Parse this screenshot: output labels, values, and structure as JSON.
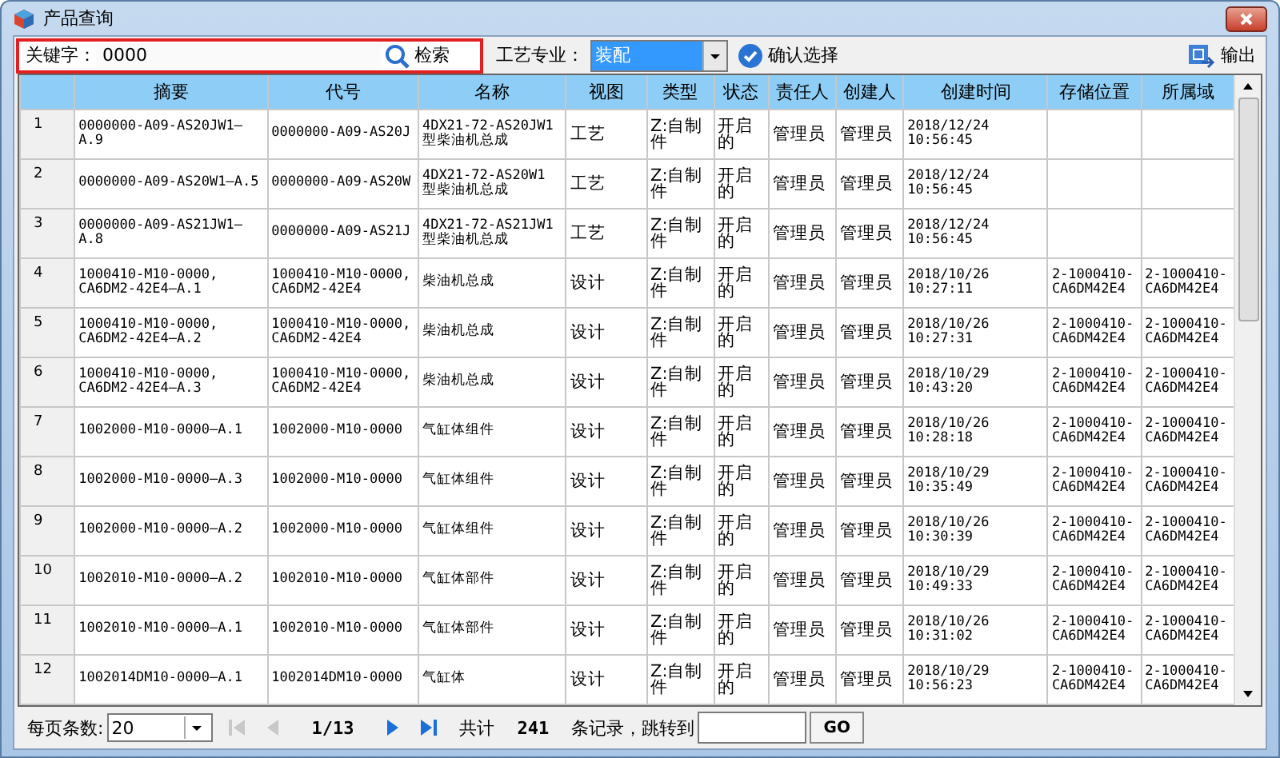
{
  "window": {
    "title": "产品查询"
  },
  "toolbar": {
    "keyword": {
      "label": "关键字：",
      "value": "0000",
      "highlighted": true
    },
    "search_button": "检索",
    "craft": {
      "label": "工艺专业：",
      "value": "装配",
      "focused": true
    },
    "confirm_button": "确认选择",
    "export_button": "输出"
  },
  "table": {
    "columns": [
      "",
      "摘要",
      "代号",
      "名称",
      "视图",
      "类型",
      "状态",
      "责任人",
      "创建人",
      "创建时间",
      "存储位置",
      "所属域"
    ],
    "rows": [
      [
        "1",
        "0000000-A09-AS20JW1—\nA.9",
        "0000000-A09-AS20J",
        "4DX21-72-AS20JW1\n型柴油机总成",
        "工艺",
        "Z:自制件",
        "开启的",
        "管理员",
        "管理员",
        "2018/12/24\n10:56:45",
        "",
        ""
      ],
      [
        "2",
        "0000000-A09-AS20W1—A.5",
        "0000000-A09-AS20W",
        "4DX21-72-AS20W1\n型柴油机总成",
        "工艺",
        "Z:自制件",
        "开启的",
        "管理员",
        "管理员",
        "2018/12/24\n10:56:45",
        "",
        ""
      ],
      [
        "3",
        "0000000-A09-AS21JW1—\nA.8",
        "0000000-A09-AS21J",
        "4DX21-72-AS21JW1\n型柴油机总成",
        "工艺",
        "Z:自制件",
        "开启的",
        "管理员",
        "管理员",
        "2018/12/24\n10:56:45",
        "",
        ""
      ],
      [
        "4",
        "1000410-M10-0000,\nCA6DM2-42E4—A.1",
        "1000410-M10-0000,\nCA6DM2-42E4",
        "柴油机总成",
        "设计",
        "Z:自制件",
        "开启的",
        "管理员",
        "管理员",
        "2018/10/26\n10:27:11",
        "2-1000410-\nCA6DM42E4",
        "2-1000410-\nCA6DM42E4"
      ],
      [
        "5",
        "1000410-M10-0000,\nCA6DM2-42E4—A.2",
        "1000410-M10-0000,\nCA6DM2-42E4",
        "柴油机总成",
        "设计",
        "Z:自制件",
        "开启的",
        "管理员",
        "管理员",
        "2018/10/26\n10:27:31",
        "2-1000410-\nCA6DM42E4",
        "2-1000410-\nCA6DM42E4"
      ],
      [
        "6",
        "1000410-M10-0000,\nCA6DM2-42E4—A.3",
        "1000410-M10-0000,\nCA6DM2-42E4",
        "柴油机总成",
        "设计",
        "Z:自制件",
        "开启的",
        "管理员",
        "管理员",
        "2018/10/29\n10:43:20",
        "2-1000410-\nCA6DM42E4",
        "2-1000410-\nCA6DM42E4"
      ],
      [
        "7",
        "1002000-M10-0000—A.1",
        "1002000-M10-0000",
        "气缸体组件",
        "设计",
        "Z:自制件",
        "开启的",
        "管理员",
        "管理员",
        "2018/10/26\n10:28:18",
        "2-1000410-\nCA6DM42E4",
        "2-1000410-\nCA6DM42E4"
      ],
      [
        "8",
        "1002000-M10-0000—A.3",
        "1002000-M10-0000",
        "气缸体组件",
        "设计",
        "Z:自制件",
        "开启的",
        "管理员",
        "管理员",
        "2018/10/29\n10:35:49",
        "2-1000410-\nCA6DM42E4",
        "2-1000410-\nCA6DM42E4"
      ],
      [
        "9",
        "1002000-M10-0000—A.2",
        "1002000-M10-0000",
        "气缸体组件",
        "设计",
        "Z:自制件",
        "开启的",
        "管理员",
        "管理员",
        "2018/10/26\n10:30:39",
        "2-1000410-\nCA6DM42E4",
        "2-1000410-\nCA6DM42E4"
      ],
      [
        "10",
        "1002010-M10-0000—A.2",
        "1002010-M10-0000",
        "气缸体部件",
        "设计",
        "Z:自制件",
        "开启的",
        "管理员",
        "管理员",
        "2018/10/29\n10:49:33",
        "2-1000410-\nCA6DM42E4",
        "2-1000410-\nCA6DM42E4"
      ],
      [
        "11",
        "1002010-M10-0000—A.1",
        "1002010-M10-0000",
        "气缸体部件",
        "设计",
        "Z:自制件",
        "开启的",
        "管理员",
        "管理员",
        "2018/10/26\n10:31:02",
        "2-1000410-\nCA6DM42E4",
        "2-1000410-\nCA6DM42E4"
      ],
      [
        "12",
        "1002014DM10-0000—A.1",
        "1002014DM10-0000",
        "气缸体",
        "设计",
        "Z:自制件",
        "开启的",
        "管理员",
        "管理员",
        "2018/10/29\n10:56:23",
        "2-1000410-\nCA6DM42E4",
        "2-1000410-\nCA6DM42E4"
      ]
    ]
  },
  "pager": {
    "page_size_label": "每页条数:",
    "page_size": "20",
    "nav": [
      {
        "kind": "first",
        "disabled": true
      },
      {
        "kind": "prev",
        "disabled": true
      },
      {
        "kind": "page",
        "text": "1/13"
      },
      {
        "kind": "next",
        "disabled": false
      },
      {
        "kind": "last",
        "disabled": false
      }
    ],
    "total_label": "共计",
    "total": "241",
    "jump_label": "条记录，跳转到",
    "go_button": "GO"
  }
}
